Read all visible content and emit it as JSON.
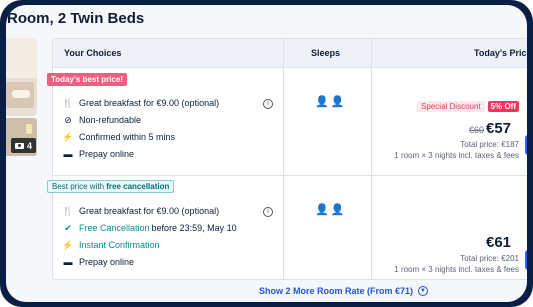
{
  "room": {
    "title": "Room, 2 Twin Beds",
    "photo_count": "4"
  },
  "table": {
    "headers": {
      "choices": "Your Choices",
      "sleeps": "Sleeps",
      "price": "Today's Price"
    },
    "rows": [
      {
        "badge": "Today's best price!",
        "features": [
          {
            "icon": "breakfast-icon",
            "text": "Great breakfast for €9.00 (optional)"
          },
          {
            "icon": "non-refundable-icon",
            "text": "Non-refundable"
          },
          {
            "icon": "lightning-icon",
            "text": "Confirmed within 5 mins"
          },
          {
            "icon": "card-icon",
            "text": "Prepay online"
          }
        ],
        "sleeps_icon": "two-guests-icon",
        "discount_label": "Special Discount",
        "discount_pct": "5% Off",
        "old_price": "€60",
        "price": "€57",
        "total": "Total price: €187",
        "detail": "1 room × 3 nights incl. taxes & fees"
      },
      {
        "badge_prefix": "Best price with ",
        "badge_strong": "free cancellation",
        "features": [
          {
            "icon": "breakfast-icon",
            "text": "Great breakfast for €9.00 (optional)"
          },
          {
            "icon": "check-circle-icon",
            "text": "Free Cancellation",
            "suffix": " before 23:59, May 10"
          },
          {
            "icon": "lightning-icon",
            "text": "Instant Confirmation"
          },
          {
            "icon": "card-icon",
            "text": "Prepay online"
          }
        ],
        "sleeps_icon": "two-guests-icon",
        "price": "€61",
        "total": "Total price: €201",
        "detail": "1 room × 3 nights incl. taxes & fees"
      }
    ]
  },
  "more_link": "Show 2 More Room Rate (From €71)",
  "colors": {
    "accent": "#3264ff",
    "teal": "#0a8c90",
    "pink": "#f05e7f",
    "frame": "#0a1f44"
  }
}
